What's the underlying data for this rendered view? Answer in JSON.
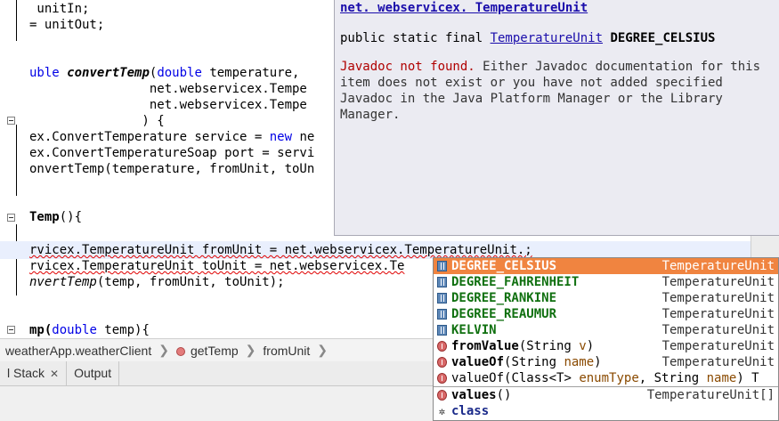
{
  "editor": {
    "lines": [
      " unitIn;",
      "= unitOut;",
      "",
      "",
      "uble convertTemp(double temperature,",
      "                net.webservicex.Tempe",
      "                net.webservicex.Tempe",
      "               ) {",
      "ex.ConvertTemperature service = new ne",
      "ex.ConvertTemperatureSoap port = servi",
      "onvertTemp(temperature, fromUnit, toUn",
      "",
      "",
      "Temp(){",
      "",
      "rvicex.TemperatureUnit fromUnit = net.webservicex.TemperatureUnit.;",
      "rvicex.TemperatureUnit toUnit = net.webservicex.Te",
      "nvertTemp(temp, fromUnit, toUnit);",
      "",
      "",
      "mp(double temp){"
    ],
    "l4_kw": "uble ",
    "l4_name": "convertTemp",
    "l4_paren": "(",
    "l4_kw2": "double",
    "l4_rest": " temperature,",
    "l8_a": "ex.ConvertTemperature service = ",
    "l8_kw": "new",
    "l8_b": " ne",
    "l13_name": "Temp",
    "l13_rest": "(){",
    "l17_name": "nvertTemp",
    "l17_rest": "(temp, fromUnit, toUnit);",
    "l20_a": "mp(",
    "l20_kw": "double",
    "l20_b": " temp){"
  },
  "javadoc": {
    "header": "net. webservicex. TemperatureUnit",
    "sig_prefix": "public static final ",
    "sig_type": "TemperatureUnit",
    "sig_name": " DEGREE_CELSIUS",
    "msg_red": "Javadoc not found.",
    "msg_rest": " Either Javadoc documentation for this item does not exist or you have not added specified Javadoc in the Java Platform Manager or the Library Manager."
  },
  "breadcrumb": {
    "items": [
      "weatherApp.weatherClient",
      "getTemp",
      "fromUnit"
    ],
    "sep": "❯"
  },
  "tabs": {
    "items": [
      "l Stack",
      "Output"
    ],
    "close": "✕"
  },
  "completion": {
    "fields": [
      {
        "name": "DEGREE_CELSIUS",
        "type": "TemperatureUnit",
        "icon": "field-icon"
      },
      {
        "name": "DEGREE_FAHRENHEIT",
        "type": "TemperatureUnit",
        "icon": "field-icon"
      },
      {
        "name": "DEGREE_RANKINE",
        "type": "TemperatureUnit",
        "icon": "field-icon"
      },
      {
        "name": "DEGREE_REAUMUR",
        "type": "TemperatureUnit",
        "icon": "field-icon"
      },
      {
        "name": "KELVIN",
        "type": "TemperatureUnit",
        "icon": "field-icon"
      }
    ],
    "methods": [
      {
        "name": "fromValue",
        "params": "(String ",
        "param": "v",
        "close": ")",
        "type": "TemperatureUnit"
      },
      {
        "name": "valueOf",
        "params": "(String ",
        "param": "name",
        "close": ")",
        "type": "TemperatureUnit"
      },
      {
        "name": "valueOf",
        "params": "(Class<T> ",
        "param": "enumType",
        "mid": ", String ",
        "param2": "name",
        "close": ") T",
        "type": ""
      }
    ],
    "after": [
      {
        "name": "values",
        "params": "()",
        "type": "TemperatureUnit[]"
      },
      {
        "name": "class",
        "type": ""
      }
    ],
    "selected_index": 0
  },
  "colors": {
    "keyword": "#0000e6",
    "selection": "#f08440",
    "field": "#107010",
    "current_line": "#e9effd"
  }
}
